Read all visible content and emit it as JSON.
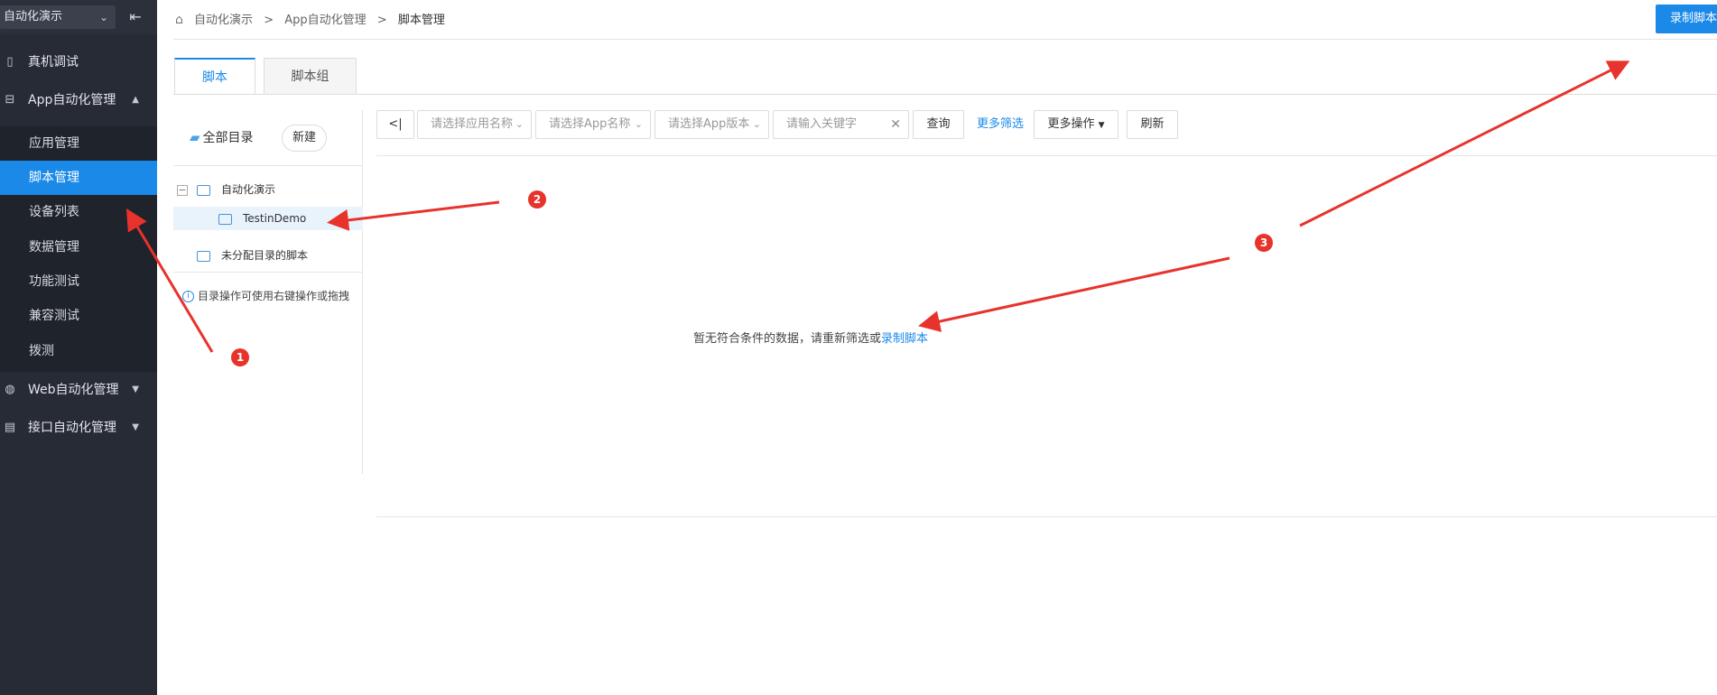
{
  "sidebar": {
    "project_select": "自动化演示",
    "nav": [
      {
        "label": "真机调试",
        "icon": "phone-icon"
      },
      {
        "label": "App自动化管理",
        "icon": "app-icon"
      },
      {
        "label": "Web自动化管理",
        "icon": "globe-icon"
      },
      {
        "label": "接口自动化管理",
        "icon": "api-icon"
      }
    ],
    "sub_items": [
      "应用管理",
      "脚本管理",
      "设备列表",
      "数据管理",
      "功能测试",
      "兼容测试",
      "拨测"
    ]
  },
  "header": {
    "breadcrumb": [
      "自动化演示",
      "App自动化管理",
      "脚本管理"
    ],
    "record_button": "录制脚本"
  },
  "tabs": [
    "脚本",
    "脚本组"
  ],
  "tree": {
    "root_label": "全部目录",
    "new_button": "新建",
    "nodes": [
      {
        "label": "自动化演示"
      },
      {
        "label": "TestinDemo"
      },
      {
        "label": "未分配目录的脚本"
      }
    ],
    "tip": "目录操作可使用右键操作或拖拽"
  },
  "filters": {
    "collapse_label": "<|",
    "app_name_select": "请选择应用名称",
    "app_select": "请选择App名称",
    "version_select": "请选择App版本",
    "keyword_placeholder": "请输入关键字",
    "query_button": "查询",
    "more_filter": "更多筛选",
    "more_ops": "更多操作",
    "refresh_button": "刷新"
  },
  "empty": {
    "message": "暂无符合条件的数据，请重新筛选或",
    "link": "录制脚本"
  },
  "annotations": [
    "1",
    "2",
    "3"
  ],
  "colors": {
    "sidebar_bg": "#272b36",
    "accent": "#1a89e8",
    "arrow": "#e8322c"
  }
}
